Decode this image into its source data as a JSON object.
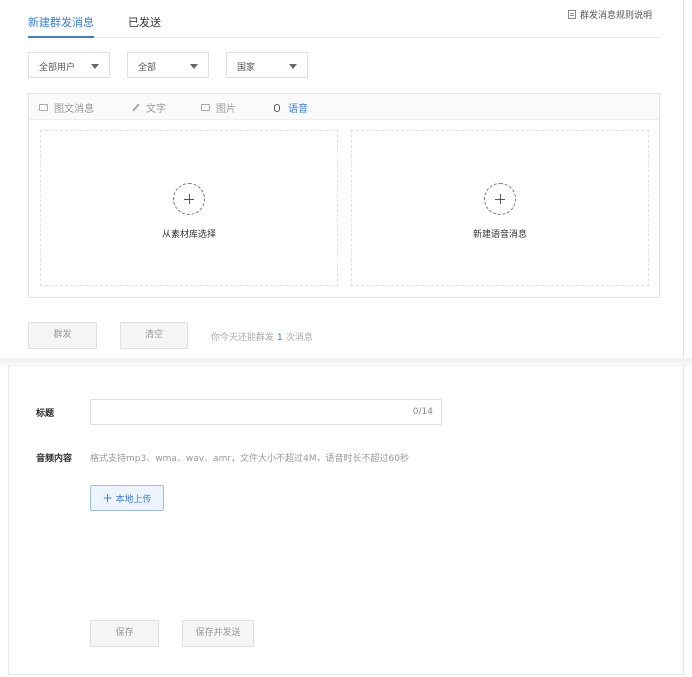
{
  "tabs": [
    {
      "label": "新建群发消息",
      "active": true
    },
    {
      "label": "已发送",
      "active": false
    }
  ],
  "rules_link": "群发消息规则说明",
  "filters": [
    {
      "value": "全部用户"
    },
    {
      "value": "全部"
    },
    {
      "value": "国家"
    }
  ],
  "message_types": [
    {
      "label": "图文消息",
      "icon": "image-text-icon",
      "active": false
    },
    {
      "label": "文字",
      "icon": "pencil-icon",
      "active": false
    },
    {
      "label": "图片",
      "icon": "picture-icon",
      "active": false
    },
    {
      "label": "语音",
      "icon": "mic-icon",
      "active": true
    }
  ],
  "drop_zones": [
    {
      "label": "从素材库选择",
      "icon": "plus-circle-icon"
    },
    {
      "label": "新建语音消息",
      "icon": "plus-circle-icon"
    }
  ],
  "actions": {
    "send_label": "群发",
    "clear_label": "清空",
    "quota_prefix": "你今天还能群发",
    "quota_count": "1",
    "quota_suffix": "次消息"
  },
  "form": {
    "title_label": "标题",
    "title_value": "",
    "title_counter": "0/14",
    "audio_label": "音频内容",
    "audio_hint": "格式支持mp3、wma、wav、amr，文件大小不超过4M，语音时长不超过60秒",
    "upload_label": "本地上传",
    "save_label": "保存",
    "save_send_label": "保存并发送"
  },
  "colors": {
    "accent": "#3b7de0",
    "border": "#e0e0e0",
    "muted_text": "#999999"
  }
}
